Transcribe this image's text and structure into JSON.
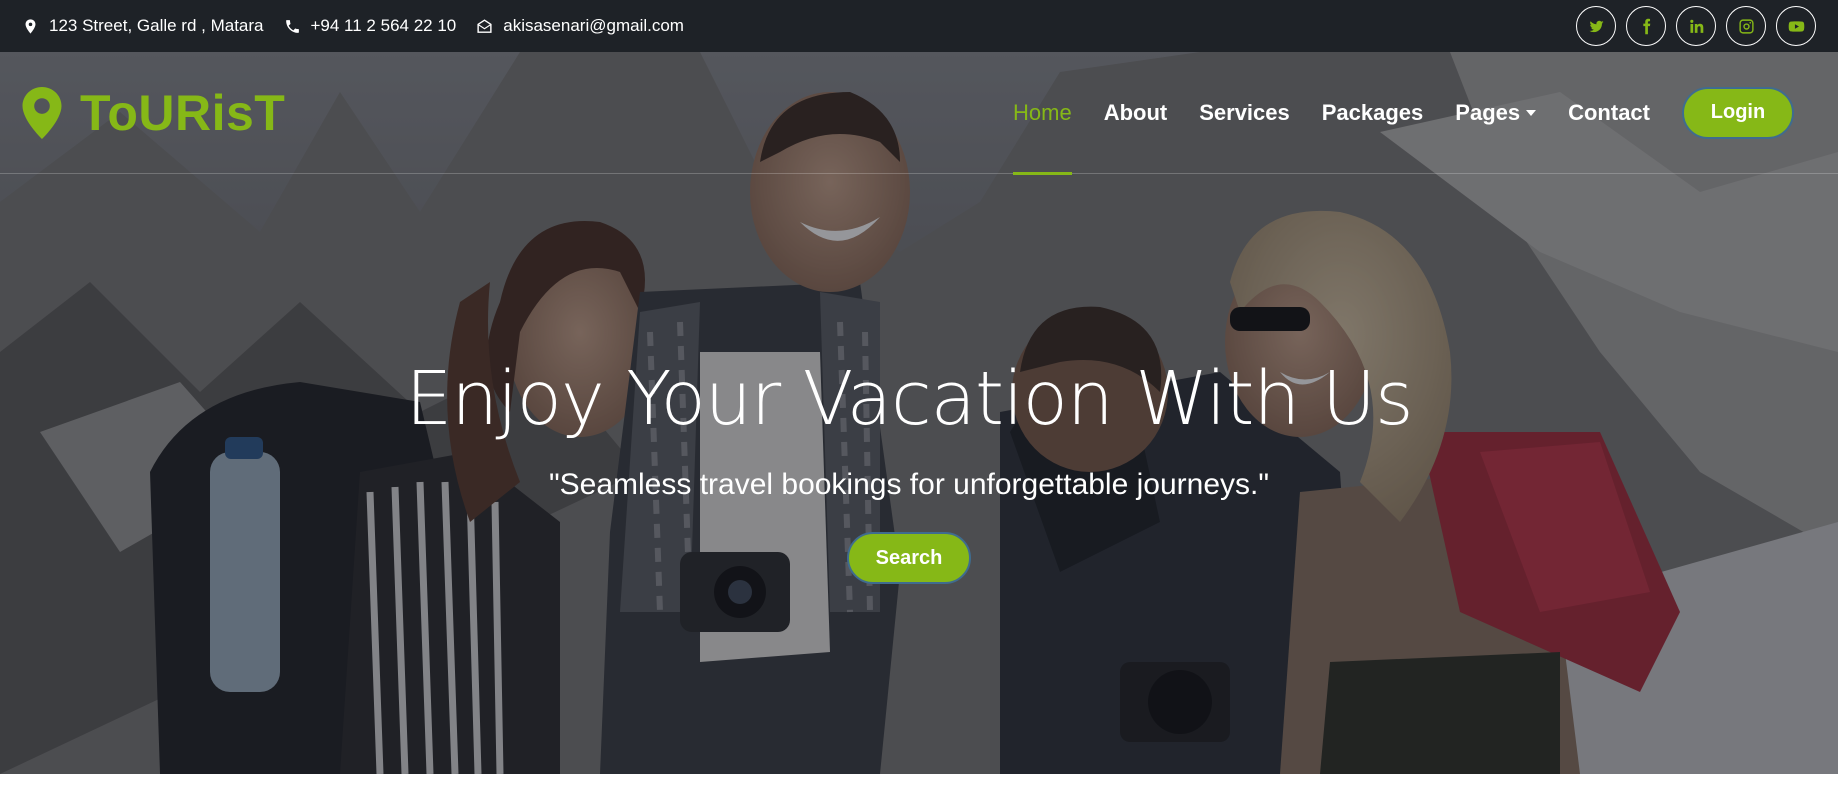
{
  "topbar": {
    "address": "123 Street, Galle rd , Matara",
    "phone": "+94 11 2 564 22 10",
    "email": "akisasenari@gmail.com",
    "social": [
      "twitter-icon",
      "facebook-icon",
      "linkedin-icon",
      "instagram-icon",
      "youtube-icon"
    ]
  },
  "brand": {
    "name": "ToURisT",
    "icon": "map-marker-icon"
  },
  "nav": {
    "home": "Home",
    "about": "About",
    "services": "Services",
    "packages": "Packages",
    "pages": "Pages",
    "contact": "Contact",
    "login": "Login",
    "active": "Home"
  },
  "hero": {
    "title": "Enjoy Your Vacation With Us",
    "subtitle": "\"Seamless travel bookings for unforgettable journeys.\"",
    "search_label": "Search"
  },
  "colors": {
    "accent": "#86b817",
    "topbar_bg": "#1e2227",
    "button_border": "#3f6c8f"
  }
}
